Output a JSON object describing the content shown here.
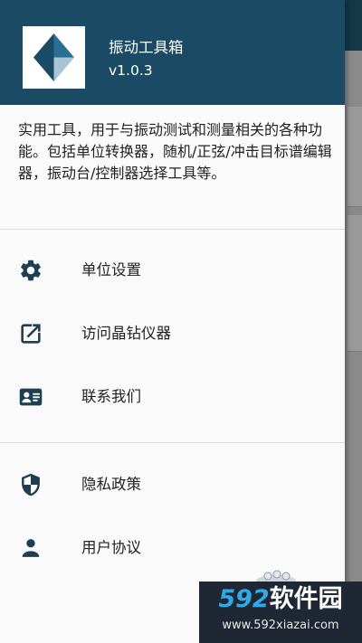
{
  "header": {
    "app_name": "振动工具箱",
    "version": "v1.0.3"
  },
  "description": "实用工具，用于与振动测试和测量相关的各种功能。包括单位转换器，随机/正弦/冲击目标谱编辑器，振动台/控制器选择工具等。",
  "menu": {
    "group1": [
      {
        "label": "单位设置",
        "icon": "gear-icon"
      },
      {
        "label": "访问晶钻仪器",
        "icon": "open-in-new-icon"
      },
      {
        "label": "联系我们",
        "icon": "contact-card-icon"
      }
    ],
    "group2": [
      {
        "label": "隐私政策",
        "icon": "shield-icon"
      },
      {
        "label": "用户协议",
        "icon": "person-icon"
      }
    ]
  },
  "watermark": {
    "brand_number": "592",
    "brand_text": "软件园",
    "url": "www.592xiazai.com"
  },
  "colors": {
    "header_background": "#1b4b64",
    "icon_color": "#1e3f52",
    "drawer_background": "#fafafa",
    "scrim": "#8a8a8a"
  }
}
